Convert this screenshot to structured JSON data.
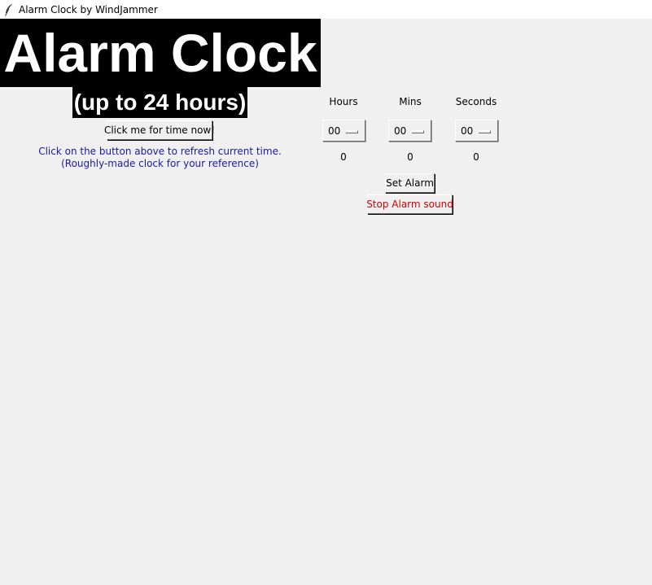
{
  "window": {
    "title": "Alarm Clock by WindJammer",
    "icon": "feather-icon"
  },
  "header": {
    "title": "Alarm Clock",
    "subtitle": "(up to 24 hours)"
  },
  "clock": {
    "time_button_label": "Click me for time now!",
    "hint_line1": "Click on the button above to refresh current time.",
    "hint_line2": "(Roughly-made clock for your reference)"
  },
  "alarm": {
    "columns": [
      {
        "label": "Hours",
        "selected": "00",
        "value": "0"
      },
      {
        "label": "Mins",
        "selected": "00",
        "value": "0"
      },
      {
        "label": "Seconds",
        "selected": "00",
        "value": "0"
      }
    ],
    "set_label": "Set Alarm",
    "stop_label": "Stop Alarm sound"
  },
  "colors": {
    "hint_text": "#1a1aa6",
    "stop_text": "#d40000",
    "title_bg": "#000000",
    "title_fg": "#ffffff",
    "window_bg": "#f0f0f0"
  }
}
